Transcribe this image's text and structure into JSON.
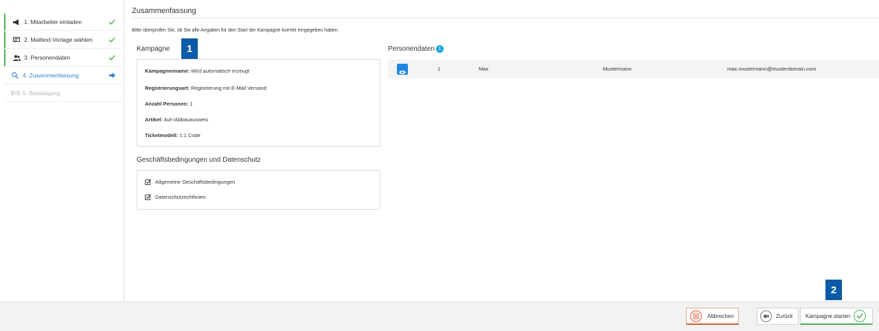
{
  "steps": [
    {
      "label": "1. Mitarbeiter einladen",
      "icon": "megaphone-icon",
      "state": "done"
    },
    {
      "label": "2. Mailtext-Vorlage wählen",
      "icon": "message-icon",
      "state": "done"
    },
    {
      "label": "3. Personendaten",
      "icon": "users-icon",
      "state": "done"
    },
    {
      "label": "4. Zusammenfassung",
      "icon": "search-icon",
      "state": "active"
    },
    {
      "label": "5. Bestätigung",
      "icon": "flag-icon",
      "state": "disabled"
    }
  ],
  "main": {
    "title": "Zusammenfassung",
    "intro": "Bitte überprüfen Sie, ob Sie alle Angaben für den Start der Kampagne korrekt eingegeben haben."
  },
  "kampagne": {
    "heading": "Kampagne",
    "badge": "1",
    "fields": [
      {
        "label": "Kampagnenname:",
        "value": "Wird automatisch erzeugt",
        "italic": true
      },
      {
        "label": "Registrierungsart:",
        "value": "Registrierung mit E-Mail Versand"
      },
      {
        "label": "Anzahl Personen:",
        "value": "1"
      },
      {
        "label": "Artikel:",
        "value": "Auf-/Abbauausweis"
      },
      {
        "label": "Ticketmodell:",
        "value": "1:1 Code"
      }
    ]
  },
  "terms": {
    "heading": "Geschäftsbedingungen und Datenschutz",
    "items": [
      "Allgemeine Geschäftsbedingungen",
      "Datenschutzrichtlinien"
    ]
  },
  "personen": {
    "heading": "Personendaten",
    "count": "1",
    "rows": [
      {
        "nr": "1",
        "firstname": "Max",
        "lastname": "Mustermann",
        "email": "max.mustermann@musterdomain.com"
      }
    ]
  },
  "footer": {
    "cancel_label": "Abbrechen",
    "back_label": "Zurück",
    "start_label": "Kampagne starten",
    "badge": "2"
  },
  "colors": {
    "done": "#4caf50",
    "active": "#2f7fd1",
    "badge": "#0b5aa8",
    "cancel": "#e2572f"
  }
}
